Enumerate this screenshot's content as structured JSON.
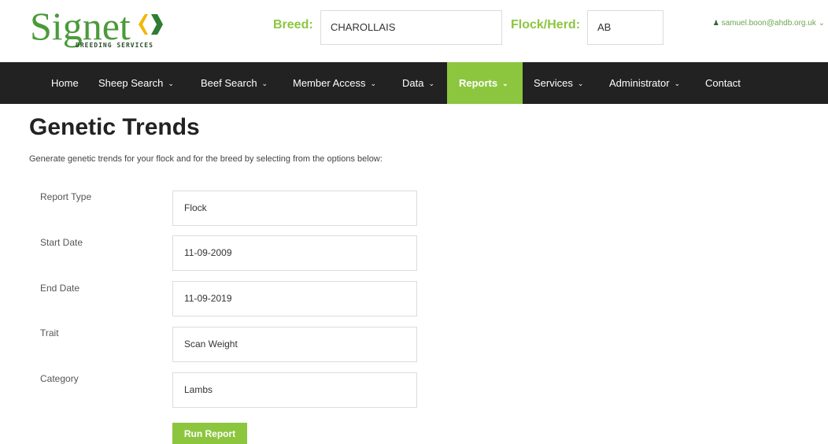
{
  "header": {
    "logo_text": "Signet",
    "logo_subtext": "BREEDING SERVICES",
    "breed_label": "Breed:",
    "breed_value": "CHAROLLAIS",
    "flock_label": "Flock/Herd:",
    "flock_value": "AB",
    "user_email": "samuel.boon@ahdb.org.uk"
  },
  "nav": {
    "items": [
      {
        "label": "Home"
      },
      {
        "label": "Sheep Search"
      },
      {
        "label": "Beef Search"
      },
      {
        "label": "Member Access"
      },
      {
        "label": "Data"
      },
      {
        "label": "Reports"
      },
      {
        "label": "Services"
      },
      {
        "label": "Administrator"
      },
      {
        "label": "Contact"
      }
    ],
    "active": "Reports"
  },
  "main": {
    "title": "Genetic Trends",
    "intro": "Generate genetic trends for your flock and for the breed by selecting from the options below:",
    "form": {
      "report_type": {
        "label": "Report Type",
        "value": "Flock"
      },
      "start_date": {
        "label": "Start Date",
        "value": "11-09-2009"
      },
      "end_date": {
        "label": "End Date",
        "value": "11-09-2019"
      },
      "trait": {
        "label": "Trait",
        "value": "Scan Weight"
      },
      "category": {
        "label": "Category",
        "value": "Lambs"
      }
    },
    "run_button": "Run Report"
  },
  "colors": {
    "accent": "#8cc63f",
    "nav_bg": "#222222",
    "logo_green": "#4a9a3a"
  }
}
